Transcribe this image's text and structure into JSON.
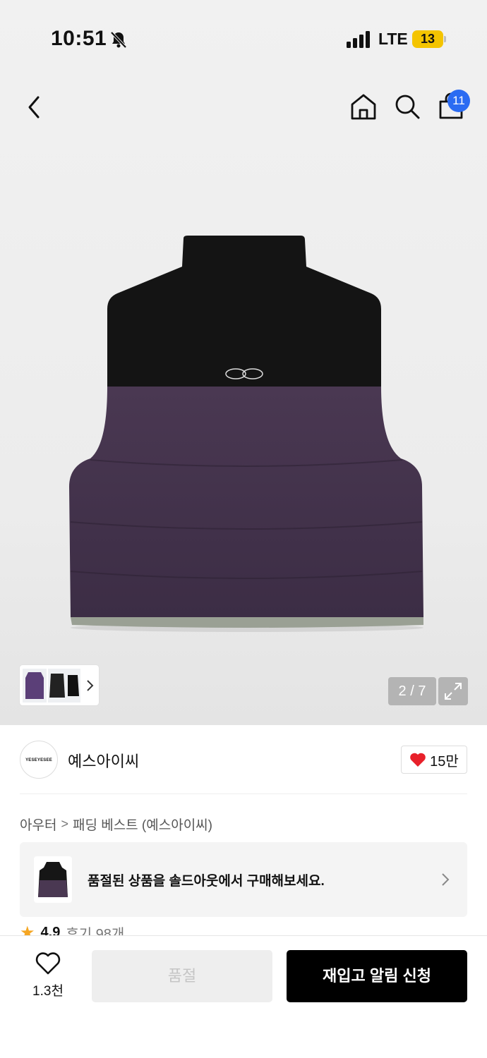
{
  "status_bar": {
    "time": "10:51",
    "network": "LTE",
    "battery": "13"
  },
  "nav": {
    "cart_count": "11"
  },
  "gallery": {
    "counter": "2 / 7"
  },
  "brand": {
    "logo_text": "YESEYESEE",
    "name": "예스아이씨",
    "likes": "15만"
  },
  "breadcrumb": {
    "category": "아우터",
    "separator": ">",
    "subcategory": "패딩 베스트 (예스아이씨)"
  },
  "soldout_notice": {
    "text": "품절된 상품을 솔드아웃에서 구매해보세요."
  },
  "rating": {
    "score": "4.9",
    "reviews": "후기 98개"
  },
  "bottom_bar": {
    "wish_count": "1.3천",
    "soldout_label": "품절",
    "restock_label": "재입고 알림 신청"
  },
  "colors": {
    "badge": "#2b6bf2",
    "heart": "#e8202a",
    "star": "#f5a623",
    "primary_button": "#000000"
  }
}
